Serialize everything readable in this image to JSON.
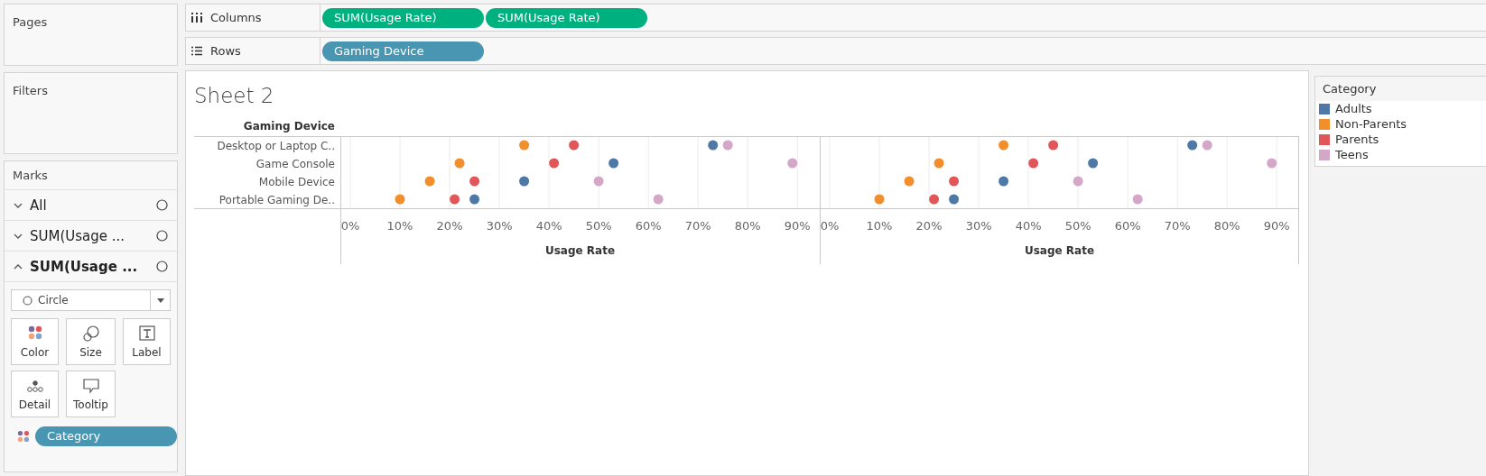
{
  "pages": {
    "title": "Pages"
  },
  "shelves": [
    {
      "kind": "columns",
      "label": "Columns",
      "pills": [
        {
          "text": "SUM(Usage Rate)",
          "kind": "measure"
        },
        {
          "text": "SUM(Usage Rate)",
          "kind": "measure"
        }
      ]
    },
    {
      "kind": "rows",
      "label": "Rows",
      "pills": [
        {
          "text": "Gaming Device",
          "kind": "dimension"
        }
      ]
    }
  ],
  "filters": {
    "title": "Filters"
  },
  "marks": {
    "title": "Marks",
    "cards": [
      {
        "label": "All",
        "expanded": false
      },
      {
        "label": "SUM(Usage ...",
        "expanded": false
      },
      {
        "label": "SUM(Usage ...",
        "expanded": true
      }
    ],
    "mark_type": "Circle",
    "buttons": [
      {
        "label": "Color",
        "kind": "color"
      },
      {
        "label": "Size",
        "kind": "size"
      },
      {
        "label": "Label",
        "kind": "label"
      },
      {
        "label": "Detail",
        "kind": "detail"
      },
      {
        "label": "Tooltip",
        "kind": "tooltip"
      }
    ],
    "fields": [
      {
        "text": "Category",
        "kind": "color"
      }
    ]
  },
  "sheet": {
    "title": "Sheet 2",
    "row_header": "Gaming Device",
    "charts": [
      {
        "chart_data": {
          "type": "scatter",
          "orientation": "horizontal",
          "grid": true,
          "xlabel": "Usage Rate",
          "categories": [
            "Desktop or Laptop C..",
            "Game Console",
            "Mobile Device",
            "Portable Gaming De.."
          ],
          "xlim": [
            -0.02,
            0.945
          ],
          "xticks": [
            {
              "value": 0,
              "label": "0%"
            },
            {
              "value": 0.1,
              "label": "10%"
            },
            {
              "value": 0.2,
              "label": "20%"
            },
            {
              "value": 0.3,
              "label": "30%"
            },
            {
              "value": 0.4,
              "label": "40%"
            },
            {
              "value": 0.5,
              "label": "50%"
            },
            {
              "value": 0.6,
              "label": "60%"
            },
            {
              "value": 0.7,
              "label": "70%"
            },
            {
              "value": 0.8,
              "label": "80%"
            },
            {
              "value": 0.9,
              "label": "90%"
            }
          ],
          "series": [
            {
              "color": "#4e79a7",
              "values": [
                0.73,
                0.53,
                0.35,
                0.25
              ]
            },
            {
              "color": "#f28e2b",
              "values": [
                0.35,
                0.22,
                0.16,
                0.1
              ]
            },
            {
              "color": "#e15759",
              "values": [
                0.45,
                0.41,
                0.25,
                0.21
              ]
            },
            {
              "color": "#d4a6c8",
              "values": [
                0.76,
                0.89,
                0.5,
                0.62
              ]
            }
          ]
        }
      },
      {
        "chart_data": {
          "type": "scatter",
          "orientation": "horizontal",
          "grid": true,
          "xlabel": "Usage Rate",
          "xlim": [
            -0.02,
            0.945
          ],
          "xticks": [
            {
              "value": 0,
              "label": "0%"
            },
            {
              "value": 0.1,
              "label": "10%"
            },
            {
              "value": 0.2,
              "label": "20%"
            },
            {
              "value": 0.3,
              "label": "30%"
            },
            {
              "value": 0.4,
              "label": "40%"
            },
            {
              "value": 0.5,
              "label": "50%"
            },
            {
              "value": 0.6,
              "label": "60%"
            },
            {
              "value": 0.7,
              "label": "70%"
            },
            {
              "value": 0.8,
              "label": "80%"
            },
            {
              "value": 0.9,
              "label": "90%"
            }
          ],
          "series": [
            {
              "color": "#4e79a7",
              "values": [
                0.73,
                0.53,
                0.35,
                0.25
              ]
            },
            {
              "color": "#f28e2b",
              "values": [
                0.35,
                0.22,
                0.16,
                0.1
              ]
            },
            {
              "color": "#e15759",
              "values": [
                0.45,
                0.41,
                0.25,
                0.21
              ]
            },
            {
              "color": "#d4a6c8",
              "values": [
                0.76,
                0.89,
                0.5,
                0.62
              ]
            }
          ]
        }
      }
    ]
  },
  "legend": {
    "title": "Category",
    "items": [
      {
        "label": "Adults",
        "color": "#4e79a7"
      },
      {
        "label": "Non-Parents",
        "color": "#f28e2b"
      },
      {
        "label": "Parents",
        "color": "#e15759"
      },
      {
        "label": "Teens",
        "color": "#d4a6c8"
      }
    ]
  }
}
